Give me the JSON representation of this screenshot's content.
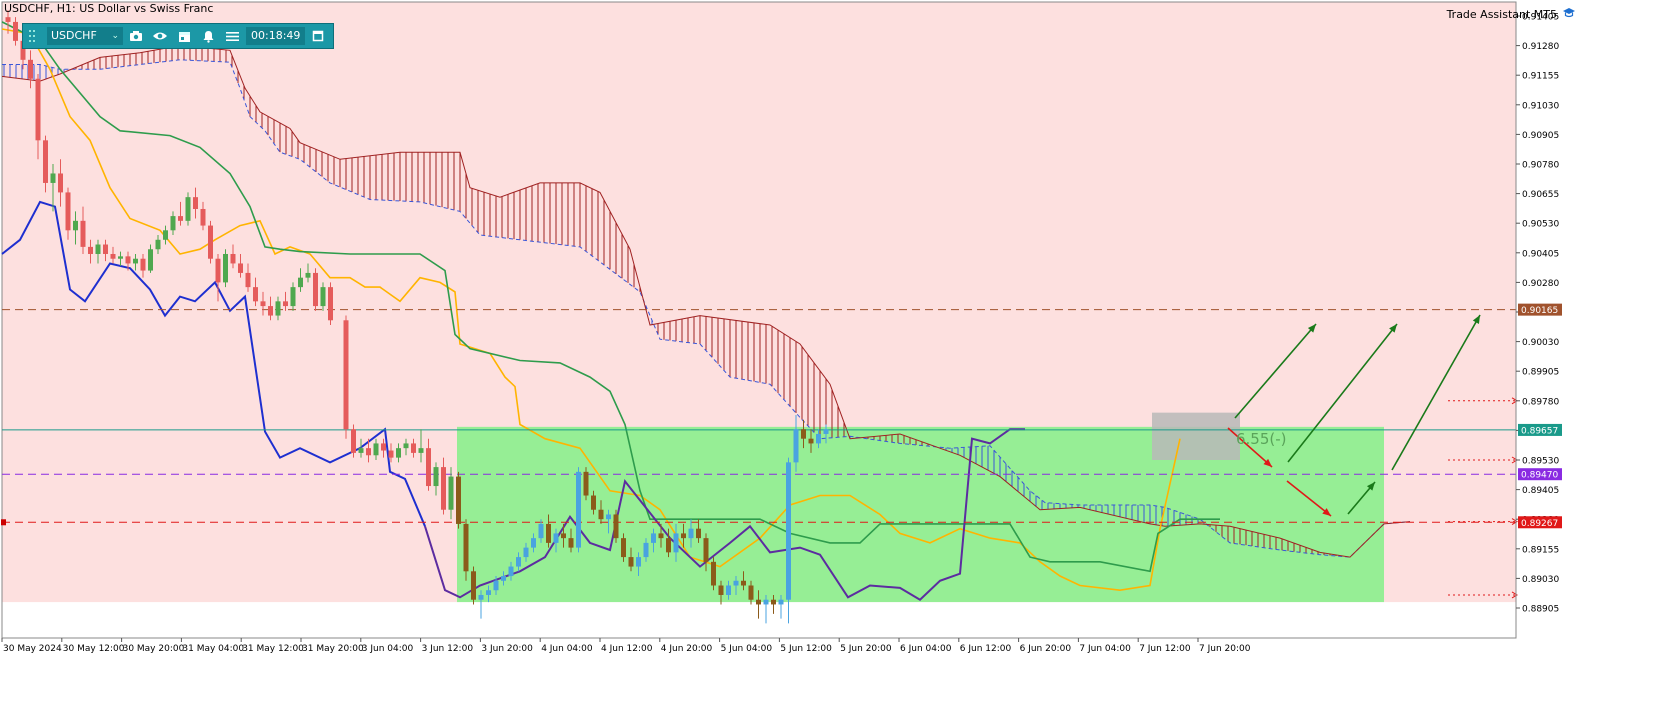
{
  "window": {
    "title": "USDCHF, H1:  US Dollar vs Swiss Franc",
    "assistant": "Trade Assistant MT5"
  },
  "toolbar": {
    "symbol": "USDCHF",
    "timer": "00:18:49",
    "icons": [
      "camera-icon",
      "eye-icon",
      "calendar-icon",
      "bell-icon",
      "menu-icon",
      "window-icon"
    ]
  },
  "colors": {
    "background": "#ffffff",
    "bearish_zone": "#fde0df",
    "range_box": "#90ee90",
    "bull_candle": "#4fa84f",
    "bear_candle": "#e55b5b",
    "tenkan": "#ffb400",
    "kijun": "#2e9c4c",
    "chikou": "#1e2fd0",
    "span_a_cloud": "#3a56d8",
    "span_b_cloud": "#a02222",
    "up_arrow": "#1a7a1a",
    "down_arrow": "#e01818",
    "level_brown": "#a0522d",
    "level_purple": "#8a2be2",
    "level_red": "#e01818",
    "current_price": "#1a9a8a"
  },
  "chart_data": {
    "type": "candlestick",
    "symbol": "USDCHF",
    "timeframe": "H1",
    "ylim": [
      0.88905,
      0.91405
    ],
    "y_ticks": [
      "0.91405",
      "0.91280",
      "0.91155",
      "0.91030",
      "0.90905",
      "0.90780",
      "0.90655",
      "0.90530",
      "0.90405",
      "0.90280",
      "0.90155",
      "0.90030",
      "0.89905",
      "0.89780",
      "0.89655",
      "0.89530",
      "0.89405",
      "0.89280",
      "0.89155",
      "0.89030",
      "0.88905"
    ],
    "x_ticks": [
      "30 May 2024",
      "30 May 12:00",
      "30 May 20:00",
      "31 May 04:00",
      "31 May 12:00",
      "31 May 20:00",
      "3 Jun 04:00",
      "3 Jun 12:00",
      "3 Jun 20:00",
      "4 Jun 04:00",
      "4 Jun 12:00",
      "4 Jun 20:00",
      "5 Jun 04:00",
      "5 Jun 12:00",
      "5 Jun 20:00",
      "6 Jun 04:00",
      "6 Jun 12:00",
      "6 Jun 20:00",
      "7 Jun 04:00",
      "7 Jun 12:00",
      "7 Jun 20:00"
    ],
    "levels": [
      {
        "name": "resistance",
        "value": 0.90165,
        "label": "0.90165",
        "color": "#a0522d",
        "style": "dashed"
      },
      {
        "name": "current",
        "value": 0.89657,
        "label": "0.89657",
        "color": "#1a9a8a",
        "style": "solid"
      },
      {
        "name": "mid",
        "value": 0.8947,
        "label": "0.89470",
        "color": "#8a2be2",
        "style": "dashed"
      },
      {
        "name": "support",
        "value": 0.89267,
        "label": "0.89267",
        "color": "#e01818",
        "style": "dashed"
      }
    ],
    "annotation": "6.55(-)",
    "candles": [
      [
        0.914,
        0.9143,
        0.9133,
        0.9138
      ],
      [
        0.9138,
        0.914,
        0.9128,
        0.913
      ],
      [
        0.913,
        0.9132,
        0.9118,
        0.9122
      ],
      [
        0.9122,
        0.9126,
        0.911,
        0.9114
      ],
      [
        0.9114,
        0.9116,
        0.908,
        0.9088
      ],
      [
        0.9088,
        0.909,
        0.9066,
        0.907
      ],
      [
        0.907,
        0.9078,
        0.9058,
        0.9074
      ],
      [
        0.9074,
        0.908,
        0.906,
        0.9066
      ],
      [
        0.9066,
        0.9068,
        0.9046,
        0.905
      ],
      [
        0.905,
        0.9058,
        0.9044,
        0.9054
      ],
      [
        0.9054,
        0.906,
        0.904,
        0.9043
      ],
      [
        0.9043,
        0.9046,
        0.9036,
        0.904
      ],
      [
        0.904,
        0.9046,
        0.9036,
        0.9044
      ],
      [
        0.9044,
        0.9046,
        0.9037,
        0.904
      ],
      [
        0.904,
        0.9043,
        0.9036,
        0.9038
      ],
      [
        0.9038,
        0.9041,
        0.9035,
        0.9039
      ],
      [
        0.9039,
        0.9041,
        0.9033,
        0.9036
      ],
      [
        0.9036,
        0.904,
        0.9033,
        0.9038
      ],
      [
        0.9038,
        0.904,
        0.903,
        0.9033
      ],
      [
        0.9033,
        0.9044,
        0.9032,
        0.9042
      ],
      [
        0.9042,
        0.9048,
        0.904,
        0.9046
      ],
      [
        0.9046,
        0.9052,
        0.9044,
        0.905
      ],
      [
        0.905,
        0.9058,
        0.9048,
        0.9056
      ],
      [
        0.9056,
        0.9062,
        0.9052,
        0.9054
      ],
      [
        0.9054,
        0.9066,
        0.9052,
        0.9064
      ],
      [
        0.9064,
        0.9068,
        0.9055,
        0.9059
      ],
      [
        0.9059,
        0.9062,
        0.905,
        0.9052
      ],
      [
        0.9052,
        0.9054,
        0.9036,
        0.9038
      ],
      [
        0.9038,
        0.904,
        0.902,
        0.9028
      ],
      [
        0.9028,
        0.9042,
        0.9026,
        0.904
      ],
      [
        0.904,
        0.9044,
        0.9034,
        0.9036
      ],
      [
        0.9036,
        0.904,
        0.903,
        0.9032
      ],
      [
        0.9032,
        0.9036,
        0.9024,
        0.9026
      ],
      [
        0.9026,
        0.903,
        0.9018,
        0.902
      ],
      [
        0.902,
        0.9024,
        0.9014,
        0.9018
      ],
      [
        0.9018,
        0.9022,
        0.9012,
        0.9014
      ],
      [
        0.9014,
        0.9022,
        0.9012,
        0.902
      ],
      [
        0.902,
        0.9024,
        0.9016,
        0.9018
      ],
      [
        0.9018,
        0.9028,
        0.9016,
        0.9026
      ],
      [
        0.9026,
        0.9034,
        0.9024,
        0.903
      ],
      [
        0.903,
        0.9036,
        0.9028,
        0.9032
      ],
      [
        0.9032,
        0.9034,
        0.9016,
        0.9018
      ],
      [
        0.9018,
        0.9028,
        0.9016,
        0.9026
      ],
      [
        0.9026,
        0.9028,
        0.901,
        0.9012
      ],
      [
        0.9012,
        0.9014,
        0.8962,
        0.8966
      ],
      [
        0.8966,
        0.8968,
        0.8954,
        0.8956
      ],
      [
        0.8956,
        0.8962,
        0.8954,
        0.8958
      ],
      [
        0.8958,
        0.8962,
        0.8952,
        0.8955
      ],
      [
        0.8955,
        0.8962,
        0.8953,
        0.896
      ],
      [
        0.896,
        0.8962,
        0.8954,
        0.8957
      ],
      [
        0.8957,
        0.896,
        0.8952,
        0.8954
      ],
      [
        0.8954,
        0.896,
        0.8952,
        0.8958
      ],
      [
        0.8958,
        0.8962,
        0.8955,
        0.896
      ],
      [
        0.896,
        0.8962,
        0.8954,
        0.8956
      ],
      [
        0.8956,
        0.8966,
        0.8952,
        0.8958
      ],
      [
        0.8958,
        0.8962,
        0.894,
        0.8942
      ],
      [
        0.8942,
        0.8952,
        0.8938,
        0.895
      ],
      [
        0.895,
        0.8954,
        0.893,
        0.8932
      ],
      [
        0.8932,
        0.895,
        0.8928,
        0.8946
      ],
      [
        0.8946,
        0.8948,
        0.8924,
        0.8926
      ],
      [
        0.8926,
        0.8928,
        0.8902,
        0.8906
      ],
      [
        0.8906,
        0.8908,
        0.8892,
        0.8894
      ],
      [
        0.8894,
        0.8898,
        0.8886,
        0.8896
      ],
      [
        0.8896,
        0.89,
        0.8893,
        0.8898
      ],
      [
        0.8898,
        0.8904,
        0.8896,
        0.8902
      ],
      [
        0.8902,
        0.8906,
        0.89,
        0.8904
      ],
      [
        0.8904,
        0.891,
        0.8902,
        0.8908
      ],
      [
        0.8908,
        0.8914,
        0.8906,
        0.8912
      ],
      [
        0.8912,
        0.8918,
        0.891,
        0.8916
      ],
      [
        0.8916,
        0.8922,
        0.8914,
        0.892
      ],
      [
        0.892,
        0.8928,
        0.8918,
        0.8926
      ],
      [
        0.8926,
        0.893,
        0.8916,
        0.8918
      ],
      [
        0.8918,
        0.8924,
        0.8914,
        0.8922
      ],
      [
        0.8922,
        0.8926,
        0.8916,
        0.892
      ],
      [
        0.892,
        0.8924,
        0.8914,
        0.8916
      ],
      [
        0.8916,
        0.895,
        0.8914,
        0.8948
      ],
      [
        0.8948,
        0.895,
        0.8936,
        0.8938
      ],
      [
        0.8938,
        0.894,
        0.893,
        0.8932
      ],
      [
        0.8932,
        0.8936,
        0.8926,
        0.8928
      ],
      [
        0.8928,
        0.8932,
        0.8922,
        0.893
      ],
      [
        0.893,
        0.8932,
        0.8918,
        0.892
      ],
      [
        0.892,
        0.8922,
        0.891,
        0.8912
      ],
      [
        0.8912,
        0.8916,
        0.8906,
        0.8908
      ],
      [
        0.8908,
        0.8914,
        0.8904,
        0.8912
      ],
      [
        0.8912,
        0.892,
        0.891,
        0.8918
      ],
      [
        0.8918,
        0.8924,
        0.8914,
        0.8922
      ],
      [
        0.8922,
        0.8926,
        0.8916,
        0.892
      ],
      [
        0.892,
        0.8924,
        0.8912,
        0.8914
      ],
      [
        0.8914,
        0.8926,
        0.891,
        0.8922
      ],
      [
        0.8922,
        0.8926,
        0.8916,
        0.892
      ],
      [
        0.892,
        0.8928,
        0.8916,
        0.8924
      ],
      [
        0.8924,
        0.8928,
        0.8918,
        0.892
      ],
      [
        0.892,
        0.8922,
        0.8906,
        0.891
      ],
      [
        0.891,
        0.8912,
        0.8898,
        0.89
      ],
      [
        0.89,
        0.8902,
        0.8892,
        0.8896
      ],
      [
        0.8896,
        0.8902,
        0.8894,
        0.89
      ],
      [
        0.89,
        0.8904,
        0.8896,
        0.8902
      ],
      [
        0.8902,
        0.8906,
        0.8898,
        0.89
      ],
      [
        0.89,
        0.8902,
        0.8892,
        0.8894
      ],
      [
        0.8894,
        0.8898,
        0.8886,
        0.8892
      ],
      [
        0.8892,
        0.8896,
        0.8884,
        0.8894
      ],
      [
        0.8894,
        0.8896,
        0.8888,
        0.8892
      ],
      [
        0.8892,
        0.8896,
        0.8886,
        0.8894
      ],
      [
        0.8894,
        0.8954,
        0.8884,
        0.8952
      ],
      [
        0.8952,
        0.8972,
        0.8948,
        0.8966
      ],
      [
        0.8966,
        0.897,
        0.8958,
        0.8962
      ],
      [
        0.8962,
        0.8966,
        0.8956,
        0.896
      ],
      [
        0.896,
        0.8966,
        0.8958,
        0.8964
      ],
      [
        0.8964,
        0.8968,
        0.896,
        0.8966
      ]
    ]
  }
}
